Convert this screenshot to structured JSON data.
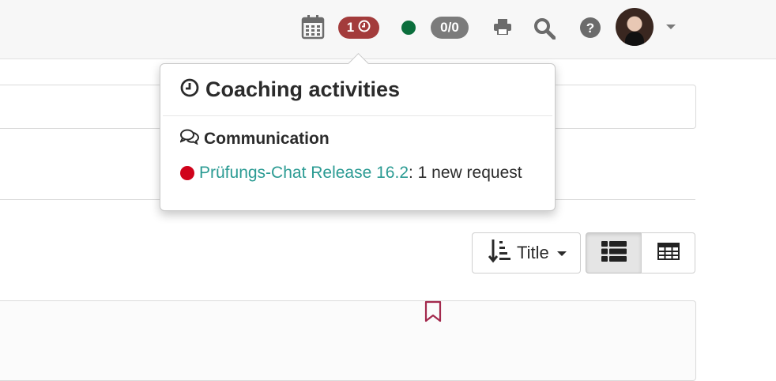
{
  "topbar": {
    "icons": [
      "calendar-icon",
      "print-icon",
      "search-icon",
      "help-icon"
    ],
    "coaching_badge": {
      "count": "1",
      "icon": "clock-icon",
      "color": "#a33c3c"
    },
    "online_status_color": "#0b6e3c",
    "chat_badge": {
      "text": "0/0",
      "color": "#7b7b7b"
    }
  },
  "popover": {
    "title": "Coaching activities",
    "section": "Communication",
    "items": [
      {
        "link": "Prüfungs-Chat Release 16.2",
        "text": ": 1 new request",
        "status_color": "#d0021b"
      }
    ]
  },
  "toolbar": {
    "sort_label": "Title",
    "views": [
      "list-view-icon",
      "table-view-icon"
    ]
  },
  "colors": {
    "accent_link": "#2b9b93",
    "bookmark": "#a3294d"
  }
}
